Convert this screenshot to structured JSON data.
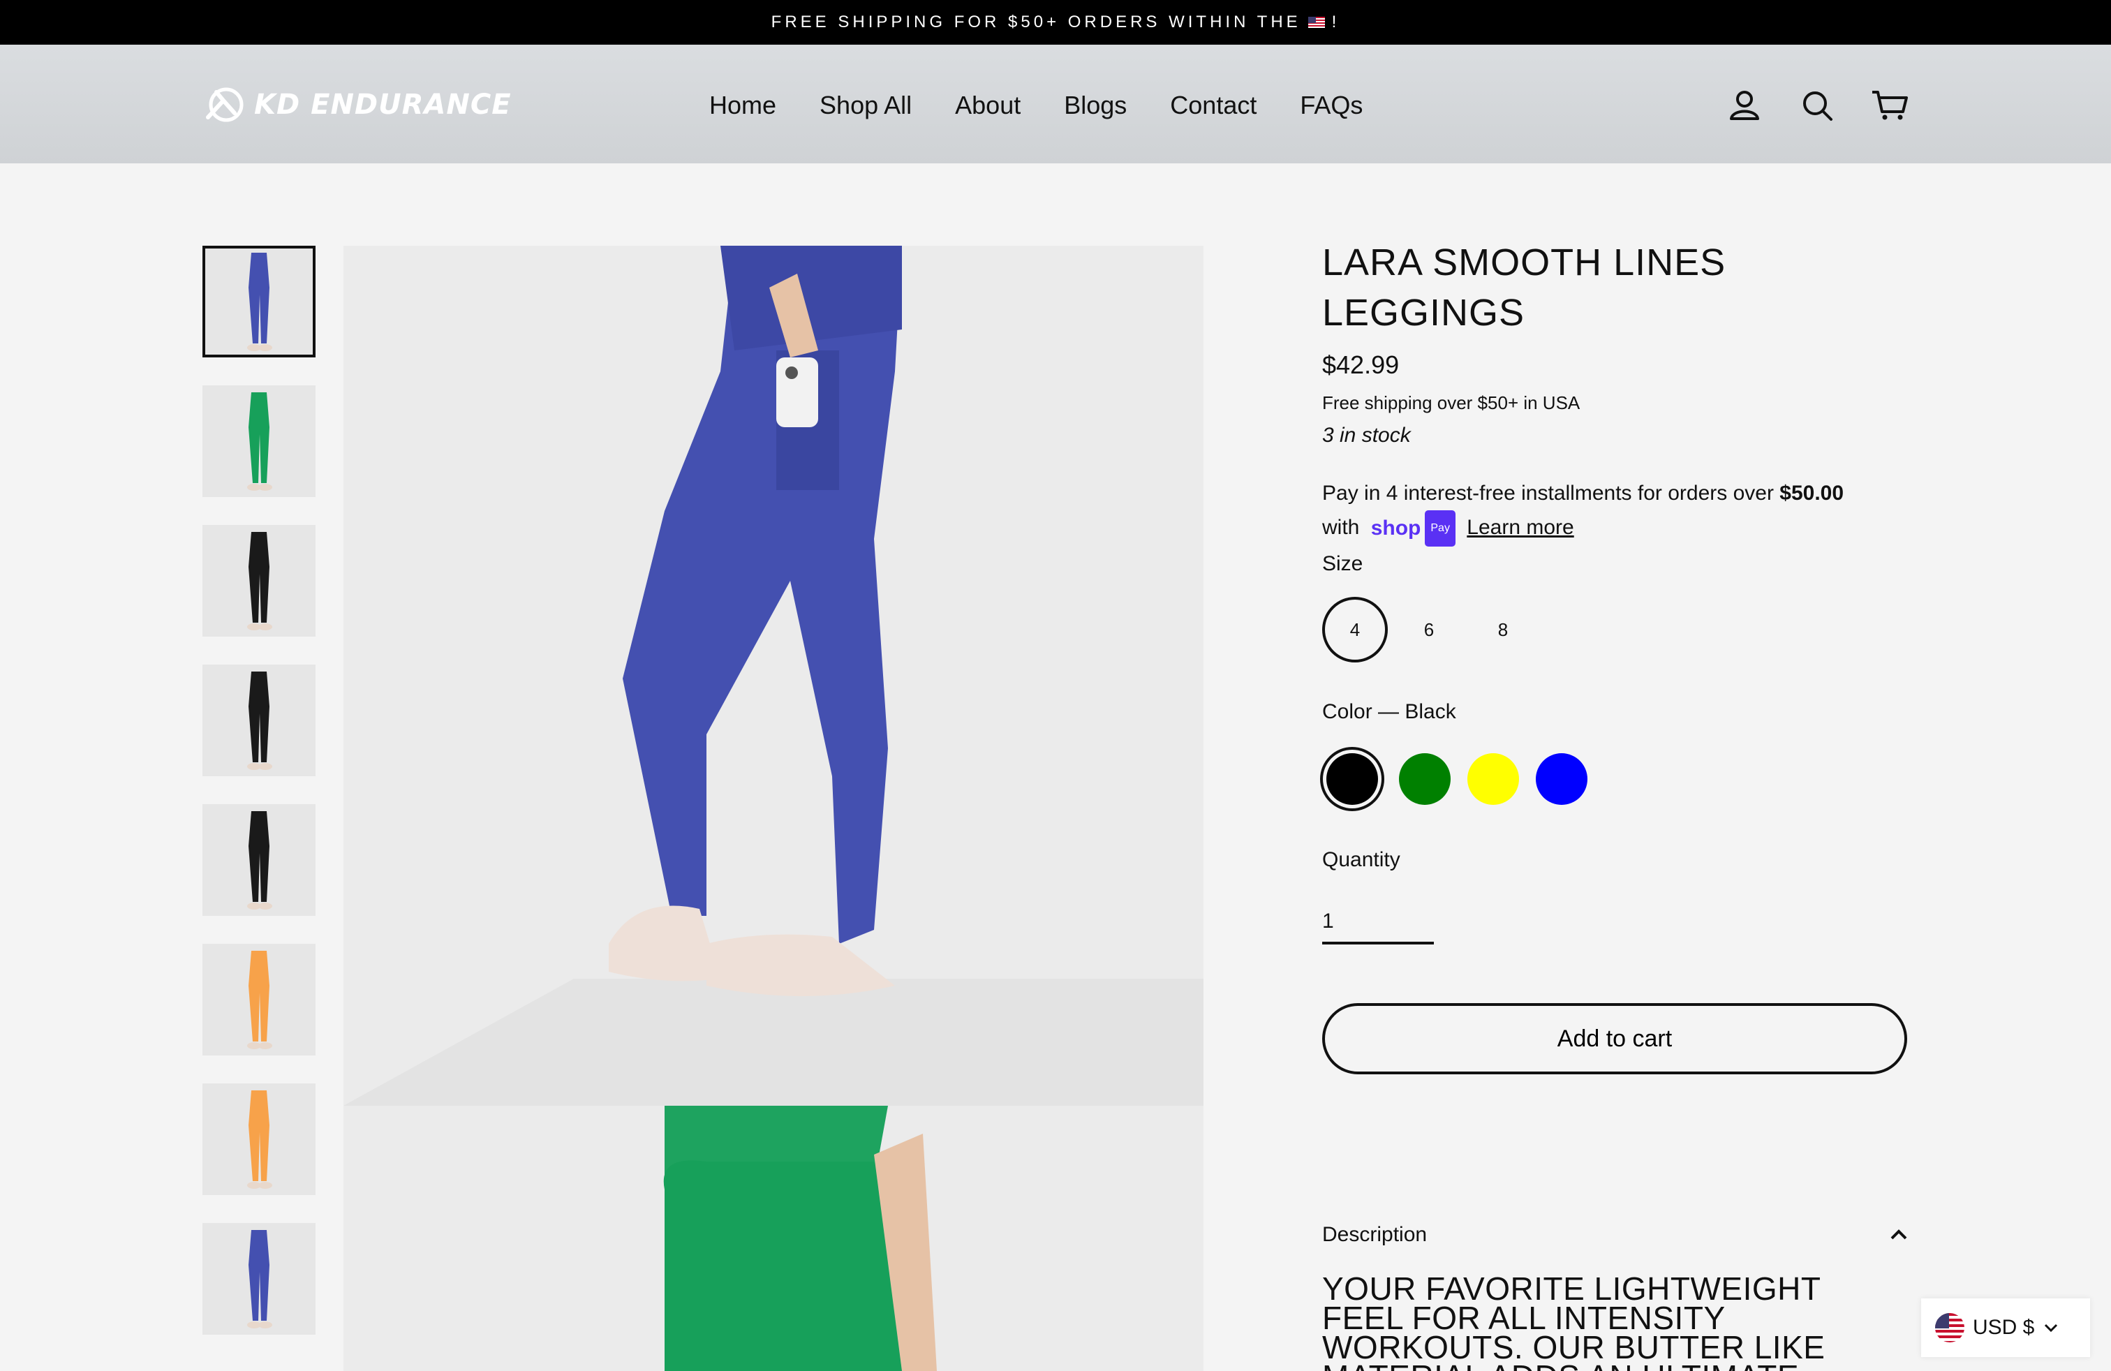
{
  "announcement": {
    "text_before": "FREE SHIPPING FOR $50+ ORDERS WITHIN THE",
    "text_after": "!"
  },
  "brand": {
    "name": "KD ENDURANCE"
  },
  "nav": [
    "Home",
    "Shop All",
    "About",
    "Blogs",
    "Contact",
    "FAQs"
  ],
  "header_icons": [
    "account-icon",
    "search-icon",
    "cart-icon"
  ],
  "gallery": {
    "thumbnails": [
      {
        "color": "#4450b0",
        "top": "#4450b0"
      },
      {
        "color": "#17a05a",
        "top": "#17a05a"
      },
      {
        "color": "#1a1a1a",
        "top": "#1a1a1a"
      },
      {
        "color": "#1a1a1a",
        "top": "#1a1a1a"
      },
      {
        "color": "#1a1a1a",
        "top": "#1a1a1a"
      },
      {
        "color": "#f7a24a",
        "top": "#f7a24a"
      },
      {
        "color": "#f7a24a",
        "top": "#f7a24a"
      },
      {
        "color": "#4450b0",
        "top": "#4450b0"
      }
    ]
  },
  "product": {
    "title": "LARA SMOOTH LINES LEGGINGS",
    "price": "$42.99",
    "shipping_note": "Free shipping over $50+ in USA",
    "stock": "3 in stock",
    "installments": {
      "text_before": "Pay in 4 interest-free installments for orders over",
      "amount": "$50.00",
      "with": "with",
      "shop_label": "shop",
      "pay_label": "Pay",
      "learn_more": "Learn more"
    },
    "size_label": "Size",
    "sizes": [
      "4",
      "6",
      "8"
    ],
    "selected_size": "4",
    "color_label": "Color — Black",
    "colors": [
      "#000000",
      "#008000",
      "#ffff00",
      "#0000ff"
    ],
    "quantity_label": "Quantity",
    "quantity_value": "1",
    "add_to_cart": "Add to cart",
    "description_label": "Description",
    "description_text": "YOUR FAVORITE LIGHTWEIGHT FEEL FOR ALL INTENSITY WORKOUTS. OUR BUTTER LIKE MATERIAL ADDS AN ULTIMATE FREEDOM DURING EXERCISE AND DAILY TASKS"
  },
  "currency": {
    "label": "USD $"
  }
}
